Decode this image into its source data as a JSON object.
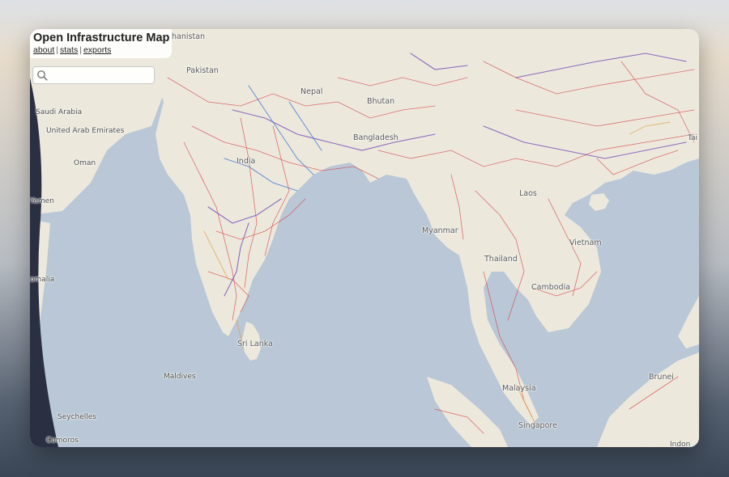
{
  "app": {
    "title": "Open Infrastructure Map",
    "links": [
      {
        "label": "about"
      },
      {
        "label": "stats"
      },
      {
        "label": "exports"
      }
    ]
  },
  "search": {
    "placeholder": "",
    "icon": "search-icon"
  },
  "map": {
    "labels": {
      "afghanistan": "hanistan",
      "pakistan": "Pakistan",
      "nepal": "Nepal",
      "bhutan": "Bhutan",
      "bangladesh": "Bangladesh",
      "india": "India",
      "saudi_arabia": "Saudi Arabia",
      "uae": "United Arab Emirates",
      "oman": "Oman",
      "yemen": "Yemen",
      "somalia": "omalia",
      "sri_lanka": "Sri Lanka",
      "maldives": "Maldives",
      "seychelles": "Seychelles",
      "comoros": "Comoros",
      "myanmar": "Myanmar",
      "laos": "Laos",
      "thailand": "Thailand",
      "vietnam": "Vietnam",
      "cambodia": "Cambodia",
      "malaysia": "Malaysia",
      "singapore": "Singapore",
      "brunei": "Brunei",
      "taiwan": "Tai",
      "indonesia": "Indon"
    },
    "colors": {
      "water": "#b9c7d6",
      "land": "#ece9dc",
      "power_line_red": "#d8424a",
      "power_line_purple": "#6b3fb8",
      "power_line_blue": "#3b6fd0",
      "power_line_orange": "#e39a3a"
    }
  }
}
